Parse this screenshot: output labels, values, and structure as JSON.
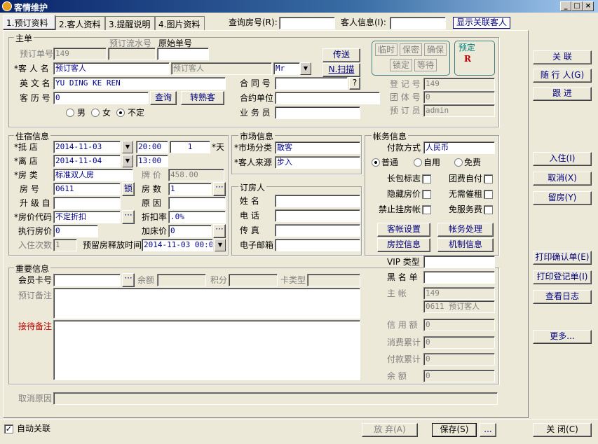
{
  "window": {
    "title": "客情维护",
    "min": "_",
    "max": "□",
    "close": "×"
  },
  "tabs": [
    "1.预订资料",
    "2.客人资料",
    "3.提醒说明",
    "4.图片资料"
  ],
  "top": {
    "room_query_label": "查询房号(R):",
    "guest_info_label": "客人信息(I):",
    "show_linked": "显示关联客人"
  },
  "master": {
    "group": "主单",
    "serial_label": "预订流水号",
    "orig_label": "原始单号",
    "resv_no_label": "预订单号",
    "resv_no": "149",
    "guest_name_label": "*客 人 名",
    "guest_name": "预订客人",
    "guest_name2": "预订客人",
    "title": "Mr",
    "en_name_label": "英 文 名",
    "en_name": "YU DING KE REN",
    "history_label": "客 历 号",
    "history": "0",
    "query_btn": "查询",
    "familiar_btn": "转熟客",
    "male": "男",
    "female": "女",
    "unknown": "不定",
    "send_btn": "传送",
    "scan_btn": "N.扫描",
    "contract_label": "合 同 号",
    "contract_help": "?",
    "company_label": "合约单位",
    "sales_label": "业 务 员",
    "flags": [
      "临时",
      "保密",
      "确保",
      "锁定",
      "等待"
    ],
    "status_label": "预定",
    "status_code": "R",
    "reg_no_label": "登 记 号",
    "reg_no": "149",
    "group_no_label": "团 体 号",
    "group_no": "0",
    "booker_label": "预 订 员",
    "booker": "admin"
  },
  "stay": {
    "group": "住宿信息",
    "arrive_label": "*抵    店",
    "arrive_date": "2014-11-03",
    "arrive_time": "20:00",
    "nights": "1",
    "days_label": "*天",
    "depart_label": "*离    店",
    "depart_date": "2014-11-04",
    "depart_time": "13:00",
    "room_type_label": "*房    类",
    "room_type": "标准双人房",
    "rack_label": "牌 价",
    "rack": "458.00",
    "room_no_label": "房    号",
    "room_no": "0611",
    "lock_btn": "锁",
    "rooms_label": "房 数",
    "rooms": "1",
    "upgrade_label": "升 级 自",
    "reason_label": "原 因",
    "rate_code_label": "*房价代码",
    "rate_code": "不定折扣",
    "discount_label": "折扣率",
    "discount": ".0%",
    "exec_rate_label": "执行房价",
    "exec_rate": "0",
    "add_rate_label": "加床价",
    "add_rate": "0",
    "checkins_label": "入住次数",
    "checkins": "1",
    "release_label": "预留房释放时间",
    "release": "2014-11-03 00:00"
  },
  "market": {
    "group": "市场信息",
    "segment_label": "*市场分类",
    "segment": "散客",
    "source_label": "*客人来源",
    "source": "步入"
  },
  "booker": {
    "group": "订房人",
    "name_label": "姓    名",
    "phone_label": "电    话",
    "fax_label": "传    真",
    "email_label": "电子邮箱"
  },
  "account": {
    "group": "帐务信息",
    "pay_label": "付款方式",
    "pay": "人民币",
    "normal": "普通",
    "self": "自用",
    "free": "免费",
    "long_label": "长包标志",
    "group_pay_label": "团费自付",
    "hidden_label": "隐藏房价",
    "no_charge_label": "无需催租",
    "ban_label": "禁止挂房帐",
    "no_service_label": "免服务费",
    "guest_acct_btn": "客帐设置",
    "acct_proc_btn": "帐务处理",
    "room_ctrl_btn": "房控信息",
    "mech_btn": "机制信息"
  },
  "important": {
    "group": "重要信息",
    "member_label": "会员卡号",
    "balance_label": "余额",
    "points_label": "积分",
    "card_type_label": "卡类型",
    "remark_label": "预订备注",
    "recept_label": "接待备注"
  },
  "vip": {
    "vip_label": "VIP 类型",
    "black_label": "黑 名 单",
    "main_label": "主    帐",
    "main": "149",
    "main2": "0611 预订客人",
    "credit_label": "信 用 额",
    "credit": "0",
    "consume_label": "消费累计",
    "consume": "0",
    "paid_label": "付款累计",
    "paid": "0",
    "rest_label": "余    额",
    "rest": "0"
  },
  "cancel_label": "取消原因",
  "side": [
    "关    联",
    "随 行 人(G)",
    "跟    进",
    "入住(I)",
    "取消(X)",
    "留房(Y)",
    "打印确认单(E)",
    "打印登记单(I)",
    "查看日志",
    "更多..."
  ],
  "bottom": {
    "auto_link": "自动关联",
    "abandon": "放  弃(A)",
    "save": "保存(S)",
    "more": "...",
    "close": "关  闭(C)"
  }
}
